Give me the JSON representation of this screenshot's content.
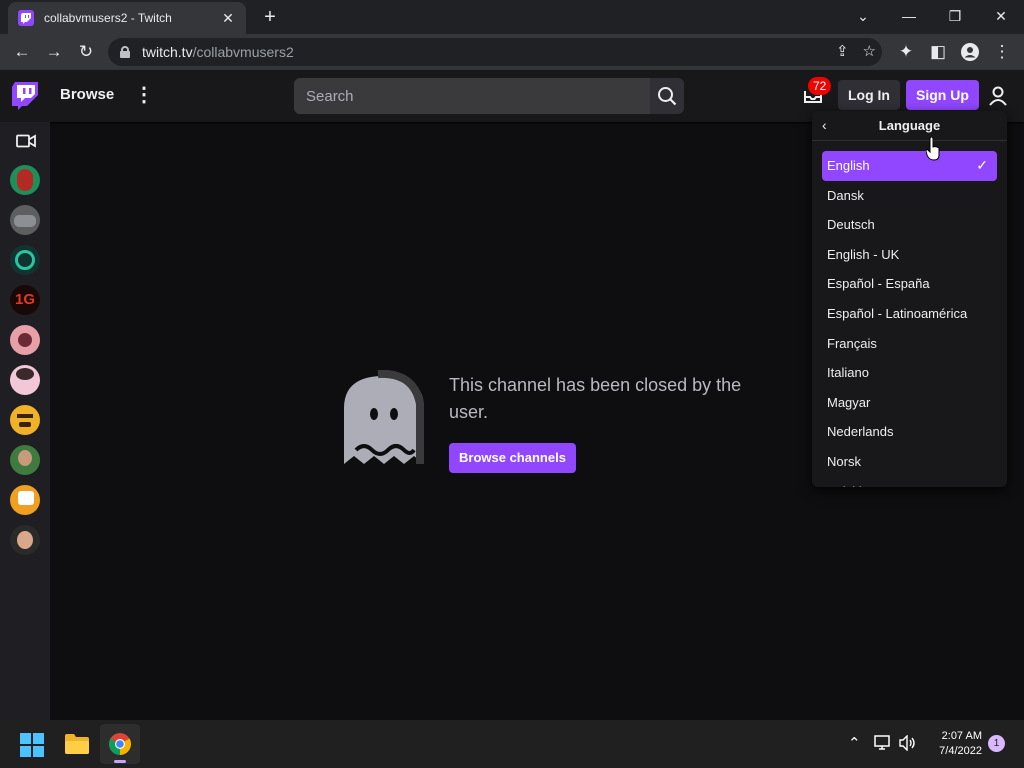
{
  "browser": {
    "tab_title": "collabvmusers2 - Twitch",
    "url_host": "twitch.tv",
    "url_path": "/collabvmusers2"
  },
  "twitch": {
    "browse_label": "Browse",
    "search_placeholder": "Search",
    "inbox_count": "72",
    "login_label": "Log In",
    "signup_label": "Sign Up",
    "accent": "#9147ff"
  },
  "main": {
    "closed_message": "This channel has been closed by the user.",
    "browse_channels_label": "Browse channels"
  },
  "language_menu": {
    "title": "Language",
    "selected": "English",
    "items": [
      "English",
      "Dansk",
      "Deutsch",
      "English - UK",
      "Español - España",
      "Español - Latinoamérica",
      "Français",
      "Italiano",
      "Magyar",
      "Nederlands",
      "Norsk",
      "Polski"
    ]
  },
  "taskbar": {
    "time": "2:07 AM",
    "date": "7/4/2022",
    "notification_count": "1"
  }
}
